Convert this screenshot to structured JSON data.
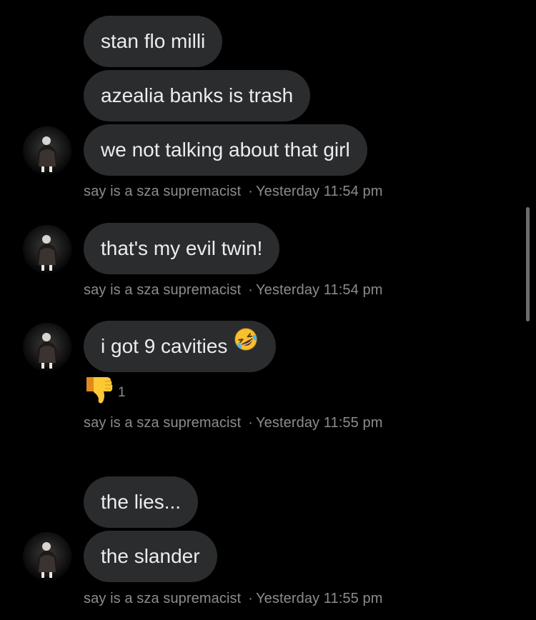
{
  "messages": [
    {
      "text": "stan flo milli"
    },
    {
      "text": "azealia banks is trash"
    },
    {
      "text": "we not talking about that girl"
    },
    {
      "text": "that's my evil twin!"
    },
    {
      "text": "i got 9 cavities"
    },
    {
      "text": "the lies..."
    },
    {
      "text": "the slander"
    }
  ],
  "reaction": {
    "icon": "thumbs-down-icon",
    "count": "1"
  },
  "meta": [
    {
      "sender": "say is a sza supremacist",
      "separator": "·",
      "time": "Yesterday 11:54 pm"
    },
    {
      "sender": "say is a sza supremacist",
      "separator": "·",
      "time": "Yesterday 11:54 pm"
    },
    {
      "sender": "say is a sza supremacist",
      "separator": "·",
      "time": "Yesterday 11:55 pm"
    },
    {
      "sender": "say is a sza supremacist",
      "separator": "·",
      "time": "Yesterday 11:55 pm"
    }
  ],
  "emoji": {
    "rofl": "rolling-on-floor-laughing-icon"
  },
  "colors": {
    "background": "#000000",
    "bubble": "#2b2c2e",
    "text": "#ececec",
    "meta": "#8c8c8f"
  }
}
